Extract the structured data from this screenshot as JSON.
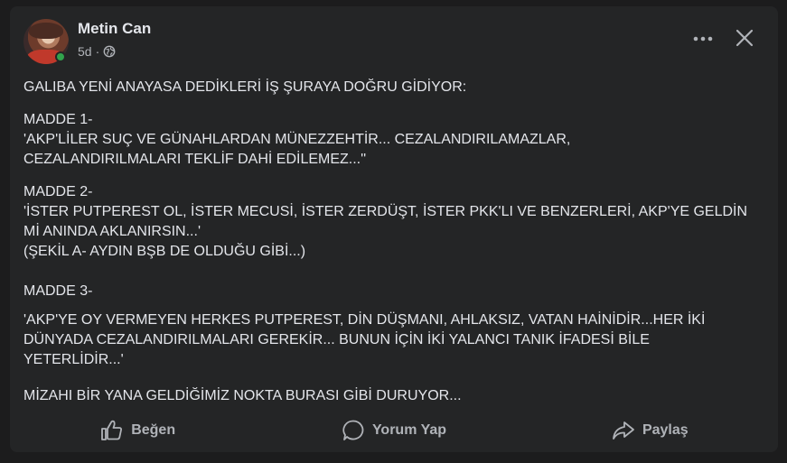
{
  "post": {
    "author": "Metin Can",
    "time": "5d",
    "separator": "·",
    "paragraphs": [
      "GALIBA YENİ ANAYASA DEDİKLERİ İŞ ŞURAYA DOĞRU GİDİYOR:",
      "MADDE 1-\n'AKP'LİLER SUÇ VE GÜNAHLARDAN MÜNEZZEHTİR... CEZALANDIRILAMAZLAR,\nCEZALANDIRILMALARI TEKLİF DAHİ EDİLEMEZ...''",
      "MADDE 2-\n'İSTER PUTPEREST OL, İSTER MECUSİ, İSTER ZERDÜŞT, İSTER PKK'LI VE BENZERLERİ, AKP'YE GELDİN\nMİ ANINDA AKLANIRSIN...'\n(ŞEKİL A- AYDIN BŞB DE OLDUĞU GİBİ...)",
      "MADDE 3-",
      "'AKP'YE OY VERMEYEN HERKES PUTPEREST, DİN DÜŞMANI, AHLAKSIZ, VATAN HAİNİDİR...HER İKİ\nDÜNYADA CEZALANDIRILMALARI GEREKİR... BUNUN İÇİN İKİ YALANCI TANIK İFADESİ BİLE\nYETERLİDİR...'",
      "MİZAHI BİR YANA GELDİĞİMİZ NOKTA BURASI GİBİ DURUYOR..."
    ]
  },
  "actions": {
    "like": "Beğen",
    "comment": "Yorum Yap",
    "share": "Paylaş"
  },
  "icons": {
    "privacy": "globe-icon",
    "more": "more-icon",
    "close": "close-icon",
    "like": "thumbs-up-icon",
    "comment": "comment-icon",
    "share": "share-icon"
  },
  "colors": {
    "background": "#1c1c1d",
    "card": "#242526",
    "text": "#e4e6eb",
    "secondary_text": "#b0b3b8",
    "online": "#31a24c"
  }
}
